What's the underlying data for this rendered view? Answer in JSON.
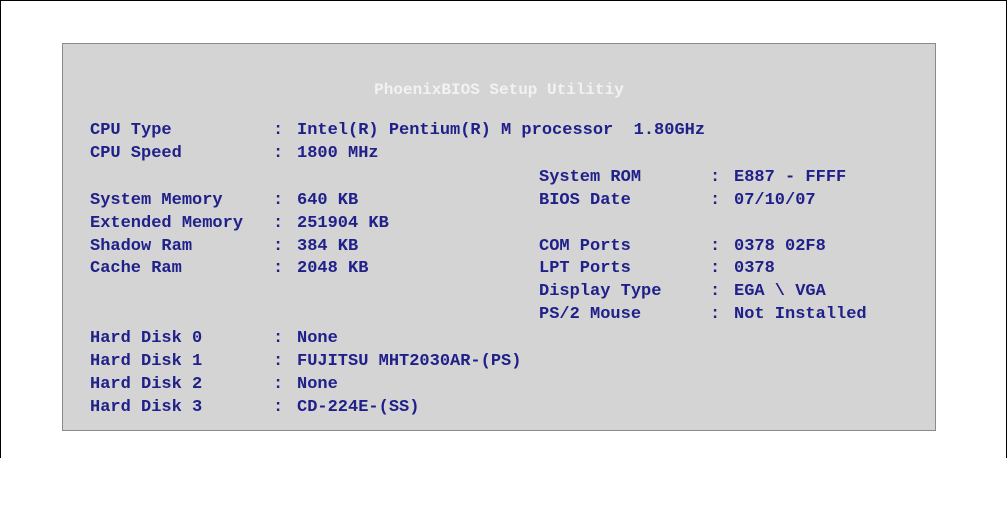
{
  "title": "PhoenixBIOS Setup Utilitiy",
  "separator": ":",
  "left": {
    "cpu_type": {
      "label": "CPU Type",
      "value": "Intel(R) Pentium(R) M processor  1.80GHz"
    },
    "cpu_speed": {
      "label": "CPU Speed",
      "value": "1800 MHz"
    },
    "system_memory": {
      "label": "System Memory",
      "value": "640 KB"
    },
    "extended_memory": {
      "label": "Extended Memory",
      "value": "251904 KB"
    },
    "shadow_ram": {
      "label": "Shadow Ram",
      "value": "384 KB"
    },
    "cache_ram": {
      "label": "Cache Ram",
      "value": "2048 KB"
    },
    "hard_disk_0": {
      "label": "Hard Disk 0",
      "value": "None"
    },
    "hard_disk_1": {
      "label": "Hard Disk 1",
      "value": "FUJITSU MHT2030AR-(PS)"
    },
    "hard_disk_2": {
      "label": "Hard Disk 2",
      "value": "None"
    },
    "hard_disk_3": {
      "label": "Hard Disk 3",
      "value": "CD-224E-(SS)"
    }
  },
  "right": {
    "system_rom": {
      "label": "System ROM",
      "value": "E887 - FFFF"
    },
    "bios_date": {
      "label": "BIOS Date",
      "value": "07/10/07"
    },
    "com_ports": {
      "label": "COM Ports",
      "value": "0378 02F8"
    },
    "lpt_ports": {
      "label": "LPT Ports",
      "value": "0378"
    },
    "display_type": {
      "label": "Display Type",
      "value": "EGA \\ VGA"
    },
    "ps2_mouse": {
      "label": "PS/2 Mouse",
      "value": "Not Installed"
    }
  }
}
